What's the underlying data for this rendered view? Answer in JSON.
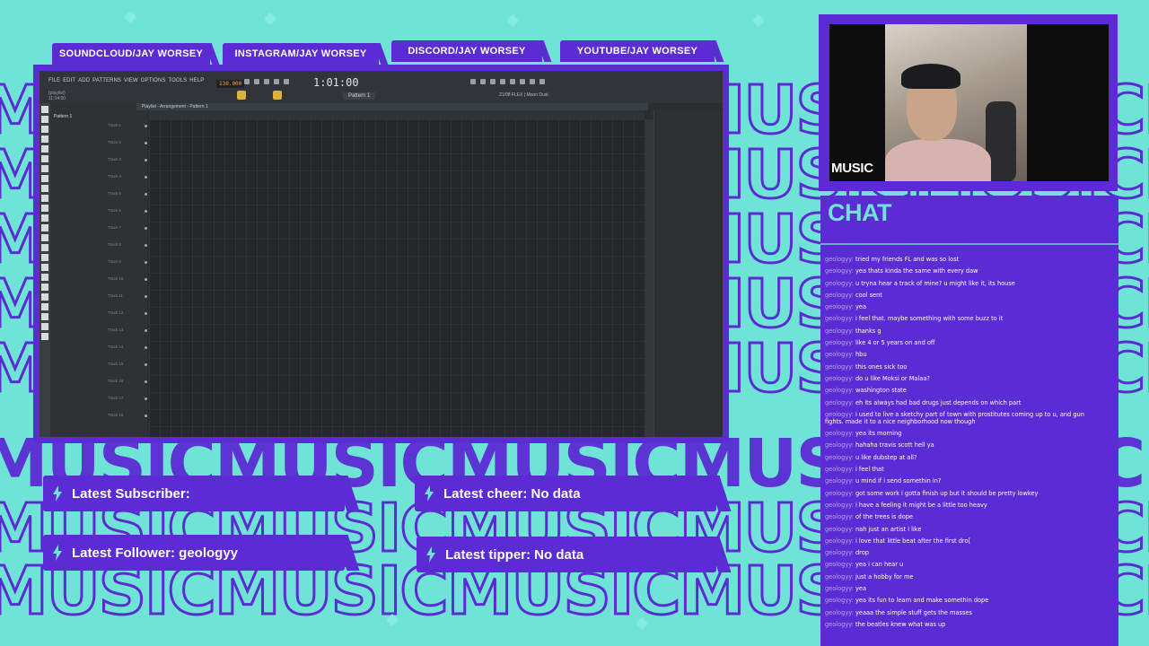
{
  "overlay": {
    "bg_word": "MUSIC",
    "socials": [
      "SOUNDCLOUD/JAY WORSEY",
      "INSTAGRAM/JAY WORSEY",
      "DISCORD/JAY WORSEY",
      "YOUTUBE/JAY WORSEY"
    ],
    "cam_label": "MUSIC",
    "accent_color": "#5b2bd3",
    "bg_color": "#6fe3d6"
  },
  "daw": {
    "menu": [
      "FILE",
      "EDIT",
      "ADD",
      "PATTERNS",
      "VIEW",
      "OPTIONS",
      "TOOLS",
      "HELP"
    ],
    "tempo": "130.000",
    "time": "1:01:00",
    "pattern": "Pattern 1",
    "playlist_title": "Playlist - Arrangement › Pattern 1",
    "pattern_item": "Pattern 1",
    "plugin_hint": "21/08 FLEX | Moon Dust",
    "hint_lines": [
      "(playlist)",
      "11:14:00"
    ],
    "tracks": [
      "Track 1",
      "Track 2",
      "Track 3",
      "Track 4",
      "Track 5",
      "Track 6",
      "Track 7",
      "Track 8",
      "Track 9",
      "Track 10",
      "Track 11",
      "Track 12",
      "Track 13",
      "Track 14",
      "Track 15",
      "Track 16",
      "Track 17",
      "Track 18"
    ]
  },
  "alerts": {
    "subscriber": "Latest Subscriber:",
    "cheer": "Latest cheer: No data",
    "follower": "Latest Follower: geologyy",
    "tipper": "Latest tipper: No data",
    "bolt_icon": "lightning-bolt-icon"
  },
  "chat": {
    "title": "CHAT",
    "messages": [
      {
        "user": "geologyy:",
        "text": "tried my friends FL and was so lost"
      },
      {
        "user": "geologyy:",
        "text": "yea thats kinda the same with every daw"
      },
      {
        "user": "geologyy:",
        "text": "u tryna hear a track of mine? u might like it, its house"
      },
      {
        "user": "geologyy:",
        "text": "cool sent"
      },
      {
        "user": "geologyy:",
        "text": "yea"
      },
      {
        "user": "geologyy:",
        "text": "i feel that. maybe something with some buzz to it"
      },
      {
        "user": "geologyy:",
        "text": "thanks g"
      },
      {
        "user": "geologyy:",
        "text": "like 4 or 5 years on and off"
      },
      {
        "user": "geologyy:",
        "text": "hbu"
      },
      {
        "user": "geologyy:",
        "text": "this ones sick too"
      },
      {
        "user": "geologyy:",
        "text": "do u like Moksi or Malaa?"
      },
      {
        "user": "geologyy:",
        "text": "washington state"
      },
      {
        "user": "geologyy:",
        "text": "eh its always had bad drugs just depends on which part"
      },
      {
        "user": "geologyy:",
        "text": "i used to live a sketchy part of town with prostitutes coming up to u, and gun fights. made it to a nice neighborhood now though"
      },
      {
        "user": "geologyy:",
        "text": "yea its morning"
      },
      {
        "user": "geologyy:",
        "text": "hahaha travis scott hell ya"
      },
      {
        "user": "geologyy:",
        "text": "u like dubstep at all?"
      },
      {
        "user": "geologyy:",
        "text": "i feel that"
      },
      {
        "user": "geologyy:",
        "text": "u mind if i send somethin in?"
      },
      {
        "user": "geologyy:",
        "text": "got some work i gotta finish up but it should be pretty lowkey"
      },
      {
        "user": "geologyy:",
        "text": "i have a feeling it might be a little too heavy"
      },
      {
        "user": "geologyy:",
        "text": "of the trees is dope"
      },
      {
        "user": "geologyy:",
        "text": "nah just an artist i like"
      },
      {
        "user": "geologyy:",
        "text": "i love that little beat after the first dro["
      },
      {
        "user": "geologyy:",
        "text": "drop"
      },
      {
        "user": "geologyy:",
        "text": "yea i can hear u"
      },
      {
        "user": "geologyy:",
        "text": "just a hobby for me"
      },
      {
        "user": "geologyy:",
        "text": "yea"
      },
      {
        "user": "geologyy:",
        "text": "yea its fun to learn and make somethin dope"
      },
      {
        "user": "geologyy:",
        "text": "yeaaa the simple stuff gets the masses"
      },
      {
        "user": "geologyy:",
        "text": "the beatles knew what was up"
      }
    ]
  }
}
